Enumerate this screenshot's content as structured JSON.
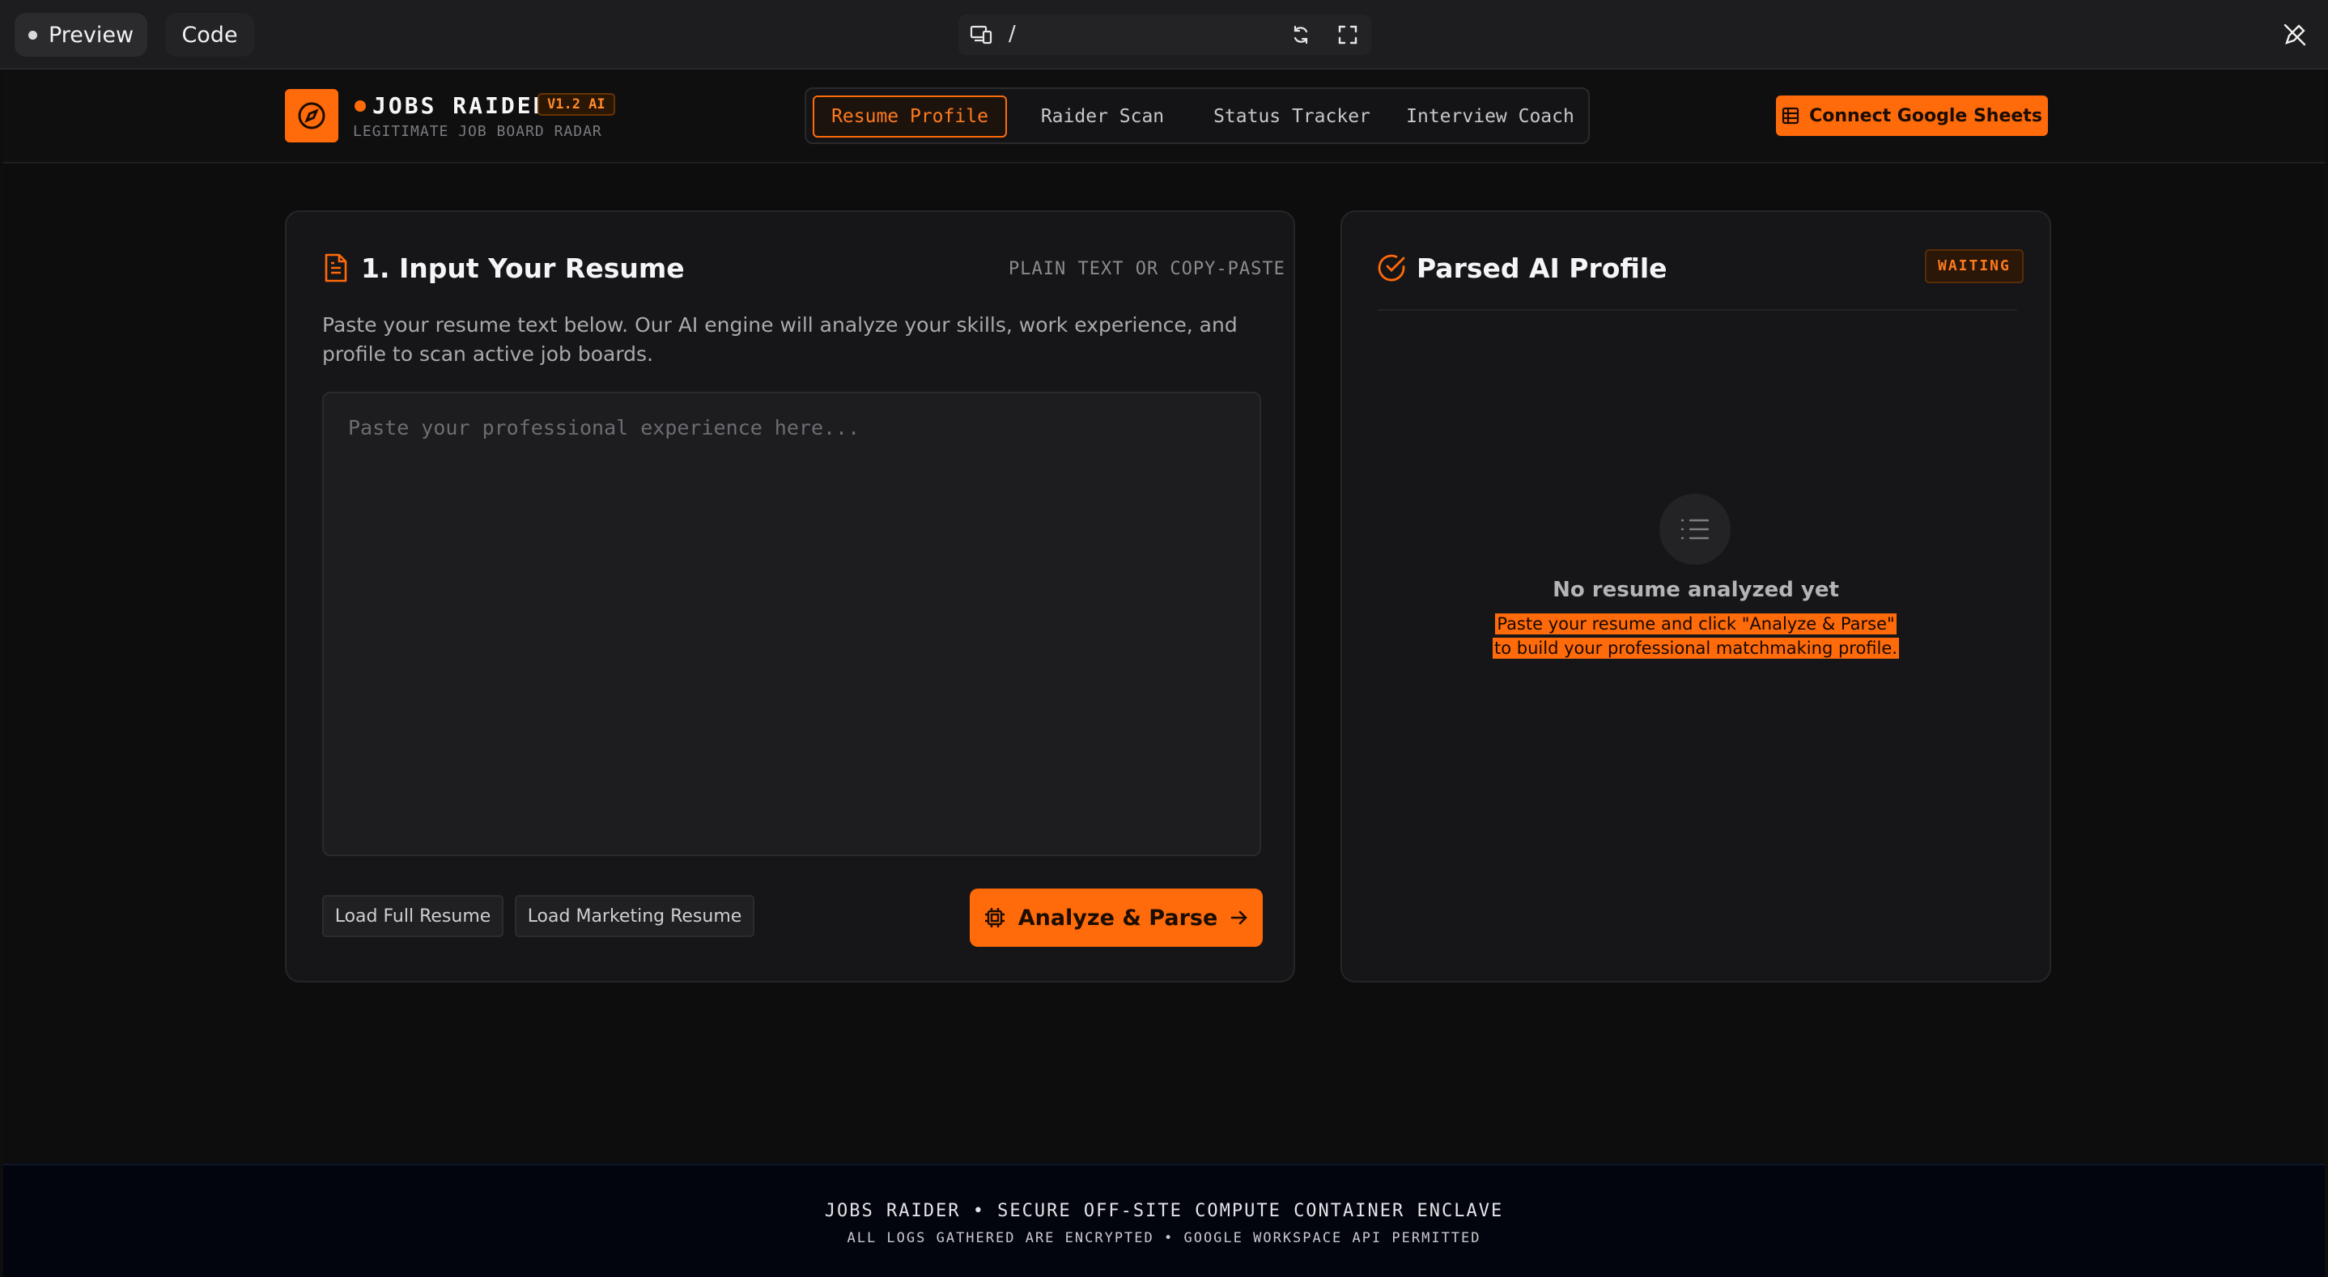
{
  "toolbar": {
    "preview_label": "Preview",
    "code_label": "Code",
    "url_path": "/"
  },
  "header": {
    "brand_name": "JOBS RAIDER",
    "version_badge": "V1.2 AI",
    "tagline": "LEGITIMATE JOB BOARD RADAR",
    "nav": [
      {
        "label": "Resume Profile",
        "active": true
      },
      {
        "label": "Raider Scan",
        "active": false
      },
      {
        "label": "Status Tracker",
        "active": false
      },
      {
        "label": "Interview Coach",
        "active": false
      }
    ],
    "connect_button": "Connect Google Sheets"
  },
  "input_card": {
    "title": "1. Input Your Resume",
    "subtitle": "PLAIN TEXT OR COPY-PASTE",
    "description": "Paste your resume text below. Our AI engine will analyze your skills, work experience, and profile to scan active job boards.",
    "textarea_placeholder": "Paste your professional experience here...",
    "textarea_value": "",
    "load_full_button": "Load Full Resume",
    "load_marketing_button": "Load Marketing Resume",
    "analyze_button": "Analyze & Parse"
  },
  "profile_card": {
    "title": "Parsed AI Profile",
    "status": "WAITING",
    "empty_title": "No resume analyzed yet",
    "empty_line1": "Paste your resume and click \"Analyze & Parse\"",
    "empty_line2": "to build your professional matchmaking profile."
  },
  "footer": {
    "line1": "JOBS RAIDER • SECURE OFF-SITE COMPUTE CONTAINER ENCLAVE",
    "line2": "ALL LOGS GATHERED ARE ENCRYPTED • GOOGLE WORKSPACE API PERMITTED"
  },
  "colors": {
    "accent": "#ff6a0a",
    "background": "#0d0d0e",
    "card": "#161618",
    "footer": "#03050e"
  },
  "icons": {
    "logo": "compass-icon",
    "sheets": "table-icon",
    "input_card": "document-icon",
    "profile_card": "check-circle-icon",
    "analyze": "cpu-icon",
    "empty_state": "list-icon"
  }
}
